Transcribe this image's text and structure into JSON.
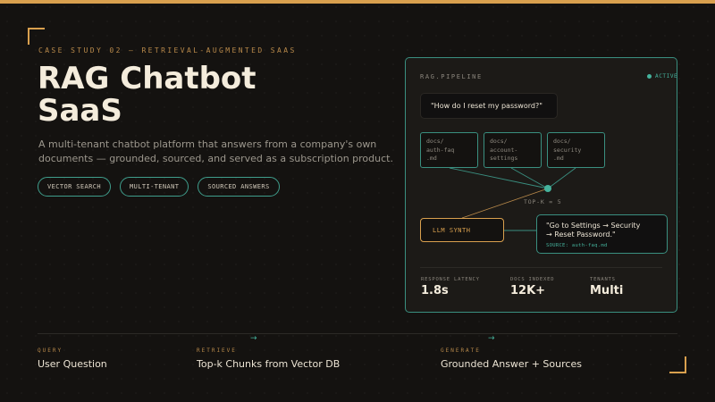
{
  "header": {
    "eyebrow": "CASE STUDY 02 — RETRIEVAL-AUGMENTED SAAS",
    "title_line1": "RAG Chatbot",
    "title_line2": "SaaS",
    "description": "A multi-tenant chatbot platform that answers from a company's own documents — grounded, sourced, and served as a subscription product."
  },
  "chips": [
    "VECTOR SEARCH",
    "MULTI-TENANT",
    "SOURCED ANSWERS"
  ],
  "pipeline": {
    "label": "RAG.PIPELINE",
    "status": "ACTIVE",
    "query": "\"How do I reset my password?\"",
    "docs": [
      "docs/\nauth-faq\n.md",
      "docs/\naccount-\nsettings",
      "docs/\nsecurity\n.md"
    ],
    "topk_label": "TOP-K = 5",
    "llm_label": "LLM SYNTH",
    "answer_line1": "\"Go to Settings → Security",
    "answer_line2": "→ Reset Password.\"",
    "answer_source": "SOURCE: auth-faq.md",
    "stats": [
      {
        "label": "RESPONSE LATENCY",
        "value": "1.8s"
      },
      {
        "label": "DOCS INDEXED",
        "value": "12K+"
      },
      {
        "label": "TENANTS",
        "value": "Multi"
      }
    ]
  },
  "steps": [
    {
      "kicker": "QUERY",
      "title": "User Question"
    },
    {
      "kicker": "RETRIEVE",
      "title": "Top-k Chunks from Vector DB"
    },
    {
      "kicker": "GENERATE",
      "title": "Grounded Answer + Sources"
    }
  ],
  "arrow_glyph": "→",
  "colors": {
    "background": "#141210",
    "accent_gold": "#d9a04e",
    "accent_teal": "#45b39d",
    "text_primary": "#f4ecdc",
    "text_muted": "#9c978d"
  }
}
